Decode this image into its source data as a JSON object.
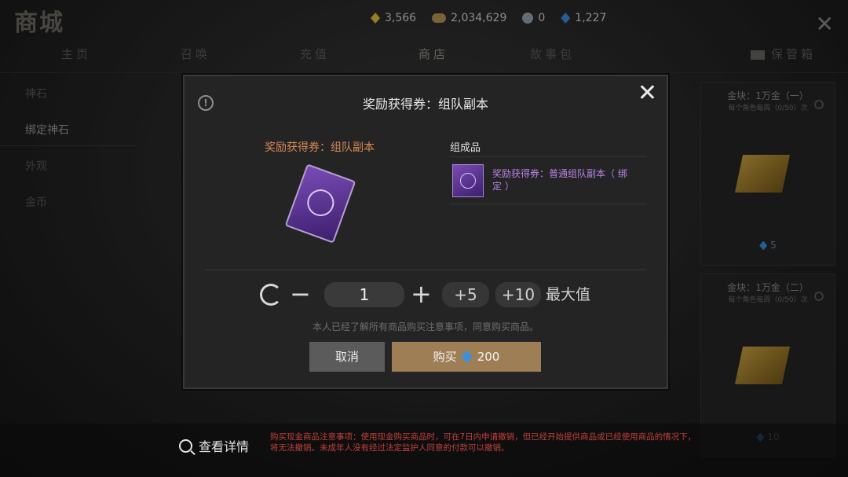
{
  "shop": {
    "title": "商城"
  },
  "currencies": [
    {
      "icon": "yellow-gem-icon",
      "value": "3,566"
    },
    {
      "icon": "gold-coin-icon",
      "value": "2,034,629"
    },
    {
      "icon": "silver-coin-icon",
      "value": "0"
    },
    {
      "icon": "blue-diamond-icon",
      "value": "1,227"
    }
  ],
  "tabs": [
    {
      "label": "主页"
    },
    {
      "label": "召唤"
    },
    {
      "label": "充值"
    },
    {
      "label": "商店"
    },
    {
      "label": "故事包"
    },
    {
      "label": "保管箱"
    }
  ],
  "sidebar": {
    "items": [
      {
        "label": "神石"
      },
      {
        "label": "绑定神石"
      },
      {
        "label": "外观"
      },
      {
        "label": "金币"
      }
    ]
  },
  "cards": [
    {
      "title": "金块：1万金（一）",
      "subtitle": "每个角色每周（0/50）次",
      "price": "5"
    },
    {
      "title": "金块：1万金（二）",
      "subtitle": "每个角色每周（0/50）次",
      "price": "10"
    }
  ],
  "dialog": {
    "title": "奖励获得券：组队副本",
    "item_name": "奖励获得券：组队副本",
    "components_title": "组成品",
    "component_name": "奖励获得券：普通组队副本（ 绑定 ）",
    "quantity": "1",
    "step_5": "+5",
    "step_10": "+10",
    "max_label": "最大值",
    "agree_text": "本人已经了解所有商品购买注意事项，同意购买商品。",
    "cancel_label": "取消",
    "buy_label": "购买",
    "buy_price": "200"
  },
  "footer": {
    "details_label": "查看详情",
    "notice": "购买现金商品注意事项：使用现金购买商品时，可在7日内申请撤销，但已经开始提供商品或已经使用商品的情况下，将无法撤销。未成年人没有经过法定监护人同意的付款可以撤销。"
  },
  "colors": {
    "accent_buy": "#9e7f55",
    "component_purple": "#b883e6",
    "item_orange": "#d78a57",
    "notice_red": "#c0413b"
  }
}
